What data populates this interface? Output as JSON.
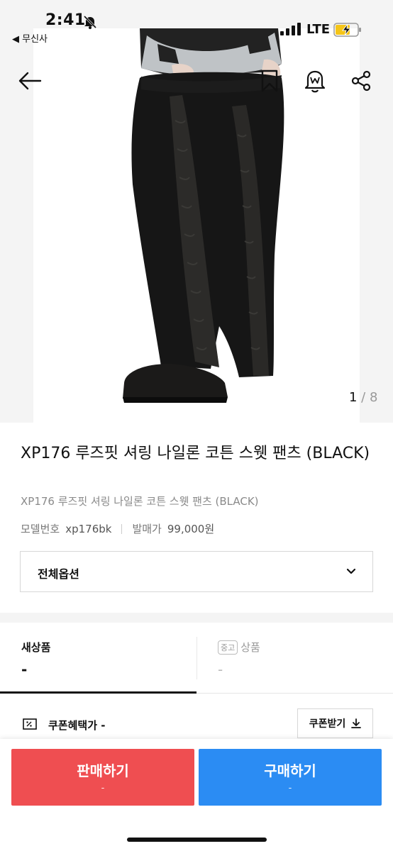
{
  "status_bar": {
    "time": "2:41",
    "back_app_label": "◀ 무신사",
    "network": "LTE"
  },
  "gallery": {
    "current": "1",
    "separator": " / ",
    "total": "8"
  },
  "product": {
    "title": "XP176 루즈핏 셔링 나일론 코튼 스웻 팬츠 (BLACK)",
    "subtitle": "XP176 루즈핏 셔링 나일론 코튼 스웻 팬츠 (BLACK)",
    "model_label": "모델번호",
    "model_value": "xp176bk",
    "release_label": "발매가",
    "release_value": "99,000원"
  },
  "options": {
    "label": "전체옵션"
  },
  "tabs": {
    "new": {
      "label": "새상품",
      "price": "-"
    },
    "used": {
      "badge": "중고",
      "label": "상품",
      "price": "-"
    }
  },
  "coupon": {
    "label": "쿠폰혜택가 -",
    "button_label": "쿠폰받기"
  },
  "actions": {
    "sell": {
      "label": "판매하기",
      "sub": "-"
    },
    "buy": {
      "label": "구매하기",
      "sub": "-"
    }
  },
  "icons": {
    "back": "arrow-left-icon",
    "bookmark": "bookmark-icon",
    "alert": "alert-bell-icon",
    "share": "share-icon",
    "chevron": "chevron-down-icon",
    "coupon": "coupon-icon",
    "download": "download-icon"
  },
  "colors": {
    "sell": "#ef4e51",
    "buy": "#2b8cf3",
    "battery": "#f5c518"
  }
}
